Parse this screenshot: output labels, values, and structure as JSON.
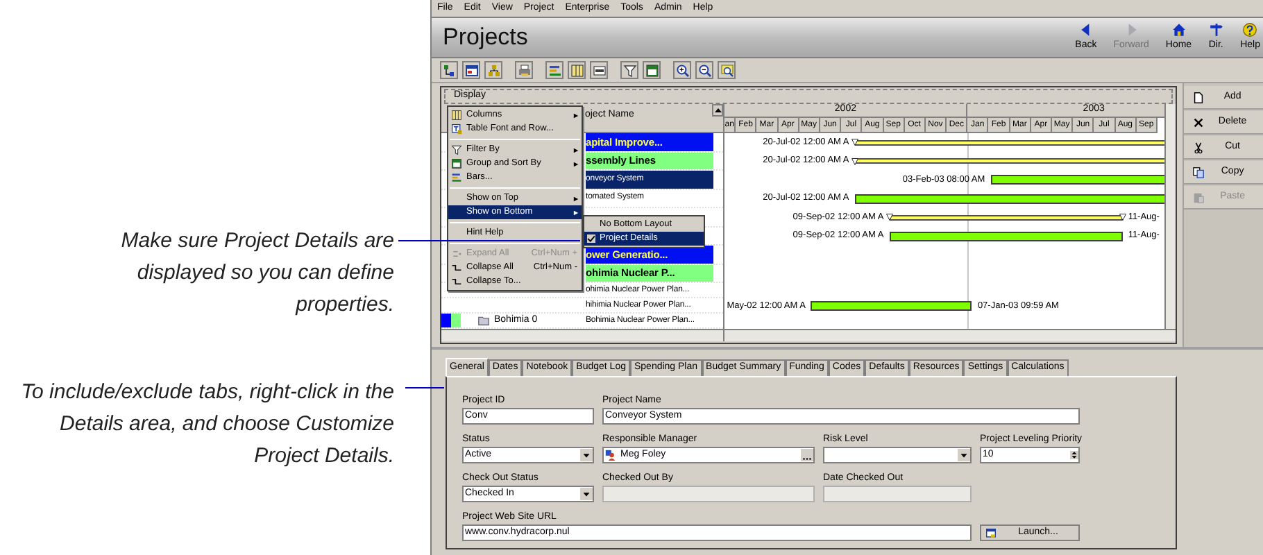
{
  "callouts": [
    "Make sure Project Details are displayed so you can define properties.",
    "To include/exclude tabs, right-click in the Details area, and choose Customize Project Details."
  ],
  "menu_bar": [
    "File",
    "Edit",
    "View",
    "Project",
    "Enterprise",
    "Tools",
    "Admin",
    "Help"
  ],
  "title": "Projects",
  "nav_buttons": [
    {
      "label": "Back",
      "kind": "back",
      "disabled": false
    },
    {
      "label": "Forward",
      "kind": "forward",
      "disabled": true
    },
    {
      "label": "Home",
      "kind": "home",
      "disabled": false
    },
    {
      "label": "Dir.",
      "kind": "directory",
      "disabled": false
    },
    {
      "label": "Help",
      "kind": "help",
      "disabled": false
    }
  ],
  "display_label": "Display",
  "table": {
    "header": "oject Name",
    "rows": [
      {
        "name": "apital Improve...",
        "kind": "group",
        "selected": false,
        "bar": {
          "kind": "baseline",
          "start_label": "20-Jul-02 12:00 AM A"
        }
      },
      {
        "name": "ssembly Lines",
        "kind": "subgroup",
        "selected": false,
        "bar": {
          "kind": "baseline",
          "start_label": "20-Jul-02 12:00 AM A"
        }
      },
      {
        "name": "onveyor System",
        "kind": "item",
        "selected": true,
        "bar": {
          "kind": "actual",
          "start_label": "03-Feb-03 08:00 AM"
        }
      },
      {
        "name": "tomated System",
        "kind": "item",
        "selected": false,
        "bar": {
          "kind": "actual",
          "start_label": "20-Jul-02 12:00 AM A"
        }
      },
      {
        "kind": "item",
        "selected": false,
        "bar": {
          "kind": "baseline",
          "start_label": "09-Sep-02 12:00 AM A",
          "end_label": "11-Aug-"
        }
      },
      {
        "kind": "item",
        "selected": false,
        "bar": {
          "kind": "actual",
          "start_label": "09-Sep-02 12:00 AM A",
          "end_label": "11-Aug-"
        }
      },
      {
        "name": "ower Generatio...",
        "kind": "group",
        "selected": false
      },
      {
        "name": "ohimia Nuclear P...",
        "kind": "subgroup",
        "selected": false
      },
      {
        "name": "ohimia Nuclear Power Plan...",
        "kind": "item",
        "selected": false
      },
      {
        "name": "hihimia Nuclear Power Plan...",
        "kind": "item",
        "selected": false,
        "bar": {
          "kind": "actual",
          "start_label": "May-02 12:00 AM A",
          "end_label": "07-Jan-03 09:59 AM"
        }
      },
      {
        "name": "Bohimia Nuclear Power Plan...",
        "outline": "Bohimia 0",
        "kind": "item",
        "selected": false,
        "color_cells": [
          {
            "color": "#0000ff"
          },
          {
            "color": "#80ff80"
          }
        ]
      }
    ]
  },
  "gantt": {
    "years": [
      "2002",
      "2003"
    ],
    "months": [
      "an",
      "Feb",
      "Mar",
      "Apr",
      "May",
      "Jun",
      "Jul",
      "Aug",
      "Sep",
      "Oct",
      "Nov",
      "Dec",
      "Jan",
      "Feb",
      "Mar",
      "Apr",
      "May",
      "Jun",
      "Jul",
      "Aug",
      "Sep"
    ]
  },
  "context_menu": [
    {
      "kind": "item",
      "label": "Columns",
      "submenu": true,
      "disabled": false,
      "selected": false
    },
    {
      "kind": "item",
      "label": "Table Font and Row...",
      "submenu": false,
      "disabled": false,
      "selected": false
    },
    {
      "kind": "separator"
    },
    {
      "kind": "item",
      "label": "Filter By",
      "submenu": true,
      "disabled": false,
      "selected": false
    },
    {
      "kind": "item",
      "label": "Group and Sort By",
      "submenu": true,
      "disabled": false,
      "selected": false
    },
    {
      "kind": "item",
      "label": "Bars...",
      "submenu": false,
      "disabled": false,
      "selected": false
    },
    {
      "kind": "separator"
    },
    {
      "kind": "item",
      "label": "Show on Top",
      "submenu": true,
      "disabled": false,
      "selected": false
    },
    {
      "kind": "item",
      "label": "Show on Bottom",
      "submenu": true,
      "disabled": false,
      "selected": true
    },
    {
      "kind": "separator"
    },
    {
      "kind": "item",
      "label": "Hint Help",
      "submenu": false,
      "disabled": false,
      "selected": false
    },
    {
      "kind": "separator"
    },
    {
      "kind": "item",
      "label": "Expand All",
      "shortcut": "Ctrl+Num +",
      "submenu": false,
      "disabled": true,
      "selected": false
    },
    {
      "kind": "item",
      "label": "Collapse All",
      "shortcut": "Ctrl+Num -",
      "submenu": false,
      "disabled": false,
      "selected": false
    },
    {
      "kind": "item",
      "label": "Collapse To...",
      "submenu": false,
      "disabled": false,
      "selected": false
    }
  ],
  "submenu": [
    {
      "label": "No Bottom Layout",
      "checked": false,
      "selected": false
    },
    {
      "label": "Project Details",
      "checked": true,
      "selected": true
    }
  ],
  "side_buttons": [
    {
      "label": "Add",
      "kind": "add",
      "disabled": false
    },
    {
      "label": "Delete",
      "kind": "delete",
      "disabled": false
    },
    {
      "label": "Cut",
      "kind": "cut",
      "disabled": false
    },
    {
      "label": "Copy",
      "kind": "copy",
      "disabled": false
    },
    {
      "label": "Paste",
      "kind": "paste",
      "disabled": true
    }
  ],
  "detail_tabs": [
    {
      "label": "General",
      "selected": true
    },
    {
      "label": "Dates",
      "selected": false
    },
    {
      "label": "Notebook",
      "selected": false
    },
    {
      "label": "Budget Log",
      "selected": false
    },
    {
      "label": "Spending Plan",
      "selected": false
    },
    {
      "label": "Budget Summary",
      "selected": false
    },
    {
      "label": "Funding",
      "selected": false
    },
    {
      "label": "Codes",
      "selected": false
    },
    {
      "label": "Defaults",
      "selected": false
    },
    {
      "label": "Resources",
      "selected": false
    },
    {
      "label": "Settings",
      "selected": false
    },
    {
      "label": "Calculations",
      "selected": false
    }
  ],
  "fields": [
    [
      {
        "label": "Project ID",
        "kind": "text",
        "value": "Conv"
      },
      {
        "label": "Project Name",
        "kind": "text",
        "value": "Conveyor System"
      }
    ],
    [
      {
        "label": "Status",
        "kind": "dropdown",
        "value": "Active"
      },
      {
        "label": "Responsible Manager",
        "kind": "person",
        "value": "Meg Foley"
      },
      {
        "label": "Risk Level",
        "kind": "dropdown"
      },
      {
        "label": "Project Leveling Priority",
        "kind": "spinner",
        "value": "10"
      }
    ],
    [
      {
        "label": "Check Out Status",
        "kind": "dropdown",
        "value": "Checked In"
      },
      {
        "label": "Checked Out By",
        "kind": "disabled"
      },
      {
        "label": "Date Checked Out",
        "kind": "disabled"
      }
    ],
    [
      {
        "label": "Project Web Site URL",
        "kind": "text",
        "value": "www.conv.hydracorp.nul"
      },
      {
        "kind": "button",
        "value": "Launch..."
      }
    ]
  ]
}
